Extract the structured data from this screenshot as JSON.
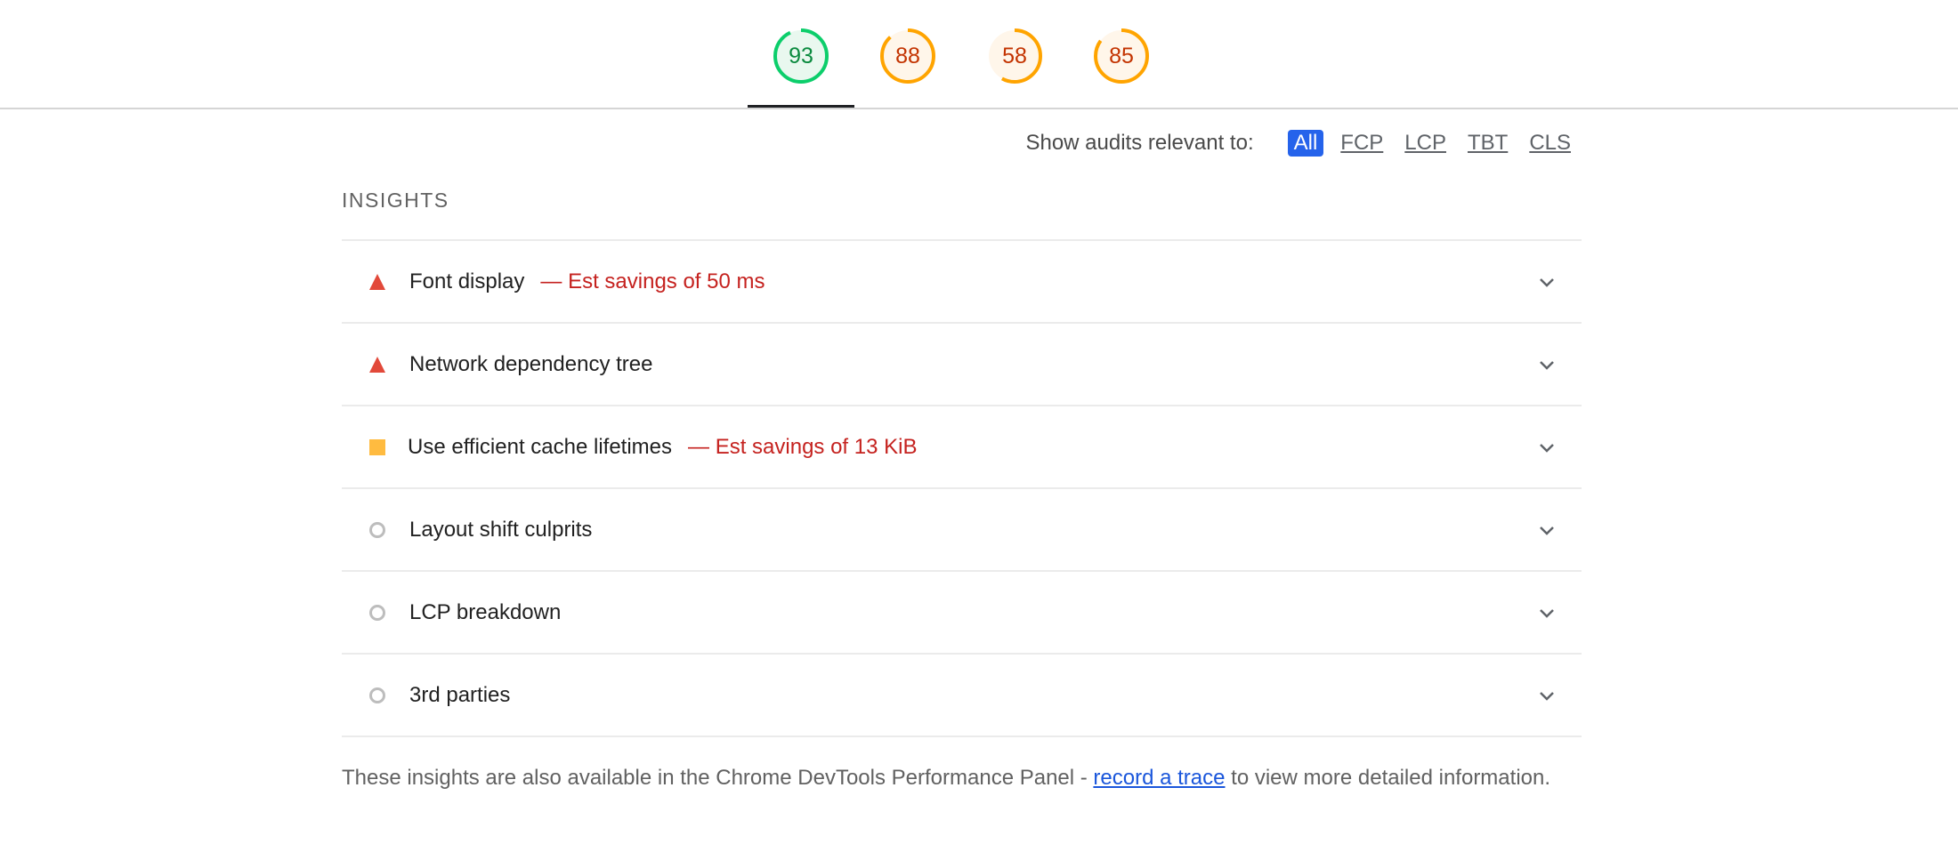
{
  "gauges": [
    {
      "score": "93",
      "fraction": 0.93,
      "status": "pass"
    },
    {
      "score": "88",
      "fraction": 0.88,
      "status": "average"
    },
    {
      "score": "58",
      "fraction": 0.58,
      "status": "average"
    },
    {
      "score": "85",
      "fraction": 0.85,
      "status": "average"
    }
  ],
  "colors": {
    "pass": "#0cce6b",
    "pass_text": "#0a8a3e",
    "average": "#ffa400",
    "average_text": "#c33300",
    "fail": "#e2493a",
    "accent": "#2563eb",
    "savings": "#c5221f",
    "link": "#1a56db"
  },
  "filter": {
    "label": "Show audits relevant to:",
    "options": [
      "All",
      "FCP",
      "LCP",
      "TBT",
      "CLS"
    ],
    "selected": "All"
  },
  "section": {
    "title": "INSIGHTS"
  },
  "audits": [
    {
      "icon": "fail-triangle-icon",
      "title": "Font display",
      "savings": "— Est savings of 50 ms"
    },
    {
      "icon": "fail-triangle-icon",
      "title": "Network dependency tree",
      "savings": ""
    },
    {
      "icon": "average-square-icon",
      "title": "Use efficient cache lifetimes",
      "savings": "— Est savings of 13 KiB"
    },
    {
      "icon": "informative-circle-icon",
      "title": "Layout shift culprits",
      "savings": ""
    },
    {
      "icon": "informative-circle-icon",
      "title": "LCP breakdown",
      "savings": ""
    },
    {
      "icon": "informative-circle-icon",
      "title": "3rd parties",
      "savings": ""
    }
  ],
  "footer": {
    "before_link": "These insights are also available in the Chrome DevTools Performance Panel - ",
    "link_text": "record a trace",
    "after_link": " to view more detailed information."
  }
}
